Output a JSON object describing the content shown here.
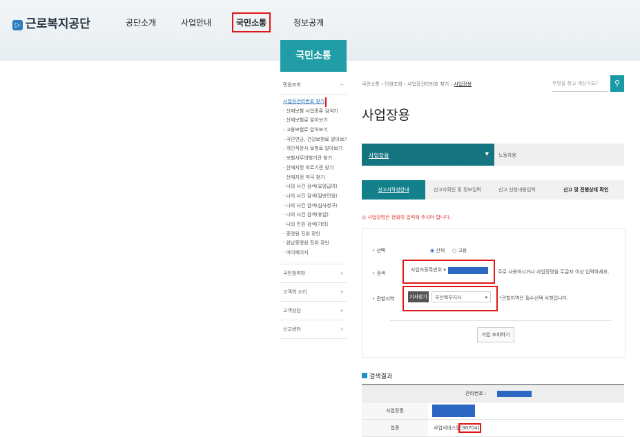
{
  "header": {
    "logo_text": "근로복지공단",
    "nav": [
      "공단소개",
      "사업안내",
      "국민소통",
      "정보공개"
    ],
    "selected_nav": "국민소통"
  },
  "sidebar": {
    "title": "국민소통",
    "sections": [
      "민원조회",
      "국민참여방",
      "고객의 소리",
      "고객상담",
      "신고센터"
    ],
    "items": [
      "사업장관리번호 찾기",
      "산재보험 사업종류 검색기",
      "산재보험료 알아보기",
      "고용보험료 알아보기",
      "국민연금, 건강보험료 알아보기",
      "개인직장사 보험료 알아보기",
      "보험사무대행기관 찾기",
      "산재지정 의료기관 찾기",
      "산재지정 약국 찾기",
      "나의 사건 검색(요양급여)",
      "나의 사건 검색(일반민원)",
      "나의 사건 검색(심사청구)",
      "나의 사건 검색(휴업)",
      "나의 민원 검색(기타)",
      "증명원 진위 확인",
      "완납증명원 진위 확인",
      "마이페이지"
    ],
    "active_item": "사업장관리번호 찾기"
  },
  "content": {
    "breadcrumb": [
      "국민소통",
      "민원조회",
      "사업장관리번호 찾기",
      "사업장용"
    ],
    "search_placeholder": "무엇을 찾고 계신가요?",
    "title": "사업장용",
    "tabs": [
      "사업장용",
      "노동자용"
    ],
    "steps": [
      "신고서작성안내",
      "신고자확인 및 정보입력",
      "신고 신청내용입력",
      "신고 및 진행상태 확인"
    ],
    "notice": "◎ 사업장명은 정확히 입력해 주셔야 합니다.",
    "form": {
      "select_label": "선택",
      "radio_options": [
        "산재",
        "고용"
      ],
      "search_label": "검색",
      "search_type": "사업자등록번호",
      "search_hint": "주로 사용하시거나 사업장명을 두글자 이상 입력하세요.",
      "region_label": "관할지역",
      "region_button": "지사찾기",
      "region_value": "부산북부지사",
      "region_hint": "*관할지역은 필수선택 사항입니다.",
      "guide_button": "가입 조회하기"
    },
    "result": {
      "title": "검색결과",
      "mgmt_label": "관리번호 :",
      "name_label": "사업장명",
      "type_label": "업종",
      "type_value": "사업서비스업",
      "type_code": "[90704]"
    }
  }
}
